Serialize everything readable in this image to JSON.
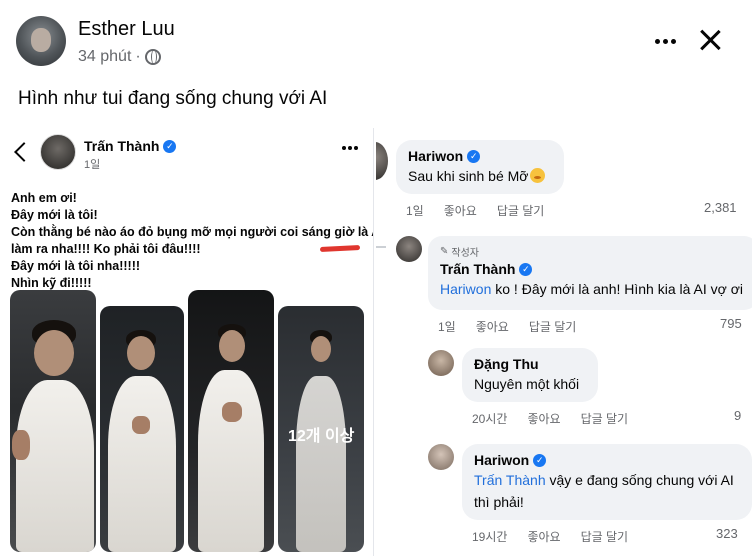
{
  "post": {
    "author": "Esther Luu",
    "time": "34 phút",
    "separator": "·",
    "caption": "Hình như tui đang sống chung với AI"
  },
  "left_post": {
    "author": "Trấn Thành",
    "time": "1일",
    "verified_icon": "✓",
    "lines": [
      "Anh em ơi!",
      "Đây mới là tôi!",
      "Còn thằng bé nào áo đỏ bụng mỡ mọi người coi sáng giờ là AI",
      "làm ra nha!!!! Ko phải tôi đâu!!!!",
      "Đây mới là tôi nha!!!!!",
      "Nhìn kỹ đi!!!!!"
    ],
    "more_photos": "12개 이상"
  },
  "comments": [
    {
      "name": "Hariwon",
      "text": "Sau khi sinh bé Mỡ",
      "time": "1일",
      "like": "좋아요",
      "reply": "답글 달기",
      "count": "2,381"
    },
    {
      "badge": "작성자",
      "name": "Trấn Thành",
      "mention": "Hariwon",
      "text": " ko ! Đây mới là anh! Hình kia là AI vợ ơi",
      "time": "1일",
      "like": "좋아요",
      "reply": "답글 달기",
      "count": "795"
    },
    {
      "name": "Đặng Thu",
      "text": "Nguyên một khối",
      "time": "20시간",
      "like": "좋아요",
      "reply": "답글 달기",
      "count": "9"
    },
    {
      "name": "Hariwon",
      "mention": "Trấn Thành",
      "text": " vậy e đang sống chung với AI",
      "text2": "thì phải!",
      "time": "19시간",
      "like": "좋아요",
      "reply": "답글 달기",
      "count": "323"
    }
  ],
  "colors": {
    "verified": "#1877f2",
    "mention": "#216fdb",
    "bubble": "#f0f2f5",
    "secondary_text": "#65676b",
    "red_mark": "#e0362e"
  },
  "icons": [
    "globe-icon",
    "more-icon",
    "close-icon",
    "back-icon",
    "verified-icon",
    "emoji-icon"
  ]
}
